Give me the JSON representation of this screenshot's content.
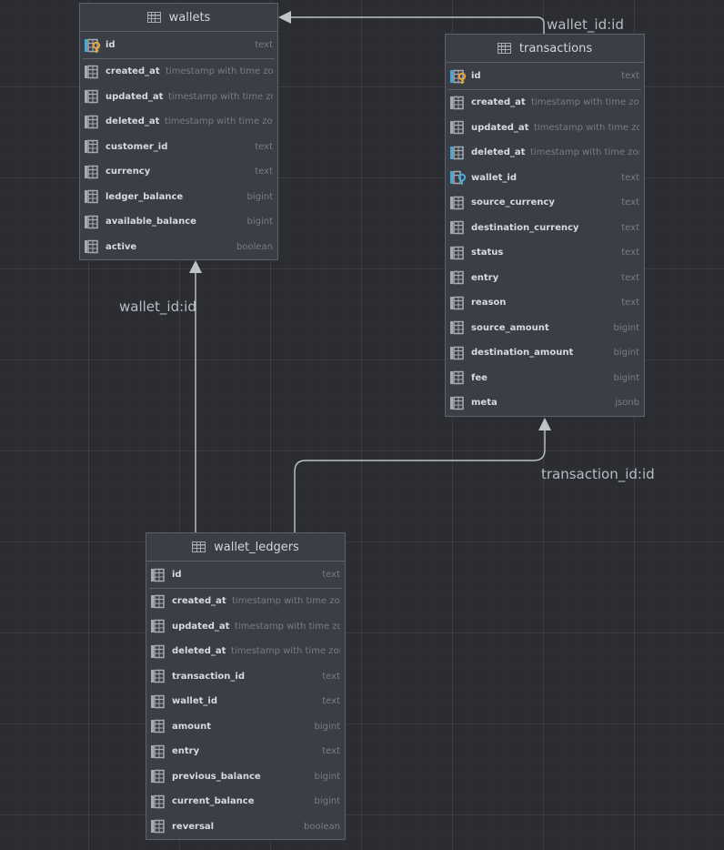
{
  "colors": {
    "background": "#2b2d33",
    "table_bg": "#3a3e45",
    "table_border": "#5d616a",
    "connector": "#c0c3c8",
    "key_icon": "#e0a33b",
    "fk_icon": "#46a9d6",
    "column_icon": "#a6aab2"
  },
  "relations": {
    "top_label": "wallet_id:id",
    "left_label": "wallet_id:id",
    "bottom_label": "transaction_id:id"
  },
  "tables": {
    "wallets": {
      "title": "wallets",
      "pk": {
        "name": "id",
        "type": "text",
        "icon": "primary-key-icon"
      },
      "columns": [
        {
          "name": "created_at",
          "type": "timestamp with time zone",
          "icon": "column-icon"
        },
        {
          "name": "updated_at",
          "type": "timestamp with time zone",
          "icon": "column-icon"
        },
        {
          "name": "deleted_at",
          "type": "timestamp with time zone",
          "icon": "column-icon"
        },
        {
          "name": "customer_id",
          "type": "text",
          "icon": "column-icon"
        },
        {
          "name": "currency",
          "type": "text",
          "icon": "column-icon"
        },
        {
          "name": "ledger_balance",
          "type": "bigint",
          "icon": "column-icon"
        },
        {
          "name": "available_balance",
          "type": "bigint",
          "icon": "column-icon"
        },
        {
          "name": "active",
          "type": "boolean",
          "icon": "column-icon"
        }
      ]
    },
    "transactions": {
      "title": "transactions",
      "pk": {
        "name": "id",
        "type": "text",
        "icon": "primary-key-icon"
      },
      "columns": [
        {
          "name": "created_at",
          "type": "timestamp with time zone",
          "icon": "column-icon"
        },
        {
          "name": "updated_at",
          "type": "timestamp with time zone",
          "icon": "column-icon"
        },
        {
          "name": "deleted_at",
          "type": "timestamp with time zone",
          "icon": "indexed-column-icon"
        },
        {
          "name": "wallet_id",
          "type": "text",
          "icon": "foreign-key-icon"
        },
        {
          "name": "source_currency",
          "type": "text",
          "icon": "column-icon"
        },
        {
          "name": "destination_currency",
          "type": "text",
          "icon": "column-icon"
        },
        {
          "name": "status",
          "type": "text",
          "icon": "column-icon"
        },
        {
          "name": "entry",
          "type": "text",
          "icon": "column-icon"
        },
        {
          "name": "reason",
          "type": "text",
          "icon": "column-icon"
        },
        {
          "name": "source_amount",
          "type": "bigint",
          "icon": "column-icon"
        },
        {
          "name": "destination_amount",
          "type": "bigint",
          "icon": "column-icon"
        },
        {
          "name": "fee",
          "type": "bigint",
          "icon": "column-icon"
        },
        {
          "name": "meta",
          "type": "jsonb",
          "icon": "column-icon"
        }
      ]
    },
    "wallet_ledgers": {
      "title": "wallet_ledgers",
      "pk": {
        "name": "id",
        "type": "text",
        "icon": "column-icon"
      },
      "columns": [
        {
          "name": "created_at",
          "type": "timestamp with time zone",
          "icon": "column-icon"
        },
        {
          "name": "updated_at",
          "type": "timestamp with time zone",
          "icon": "column-icon"
        },
        {
          "name": "deleted_at",
          "type": "timestamp with time zone",
          "icon": "column-icon"
        },
        {
          "name": "transaction_id",
          "type": "text",
          "icon": "column-icon"
        },
        {
          "name": "wallet_id",
          "type": "text",
          "icon": "column-icon"
        },
        {
          "name": "amount",
          "type": "bigint",
          "icon": "column-icon"
        },
        {
          "name": "entry",
          "type": "text",
          "icon": "column-icon"
        },
        {
          "name": "previous_balance",
          "type": "bigint",
          "icon": "column-icon"
        },
        {
          "name": "current_balance",
          "type": "bigint",
          "icon": "column-icon"
        },
        {
          "name": "reversal",
          "type": "boolean",
          "icon": "column-icon"
        }
      ]
    }
  }
}
